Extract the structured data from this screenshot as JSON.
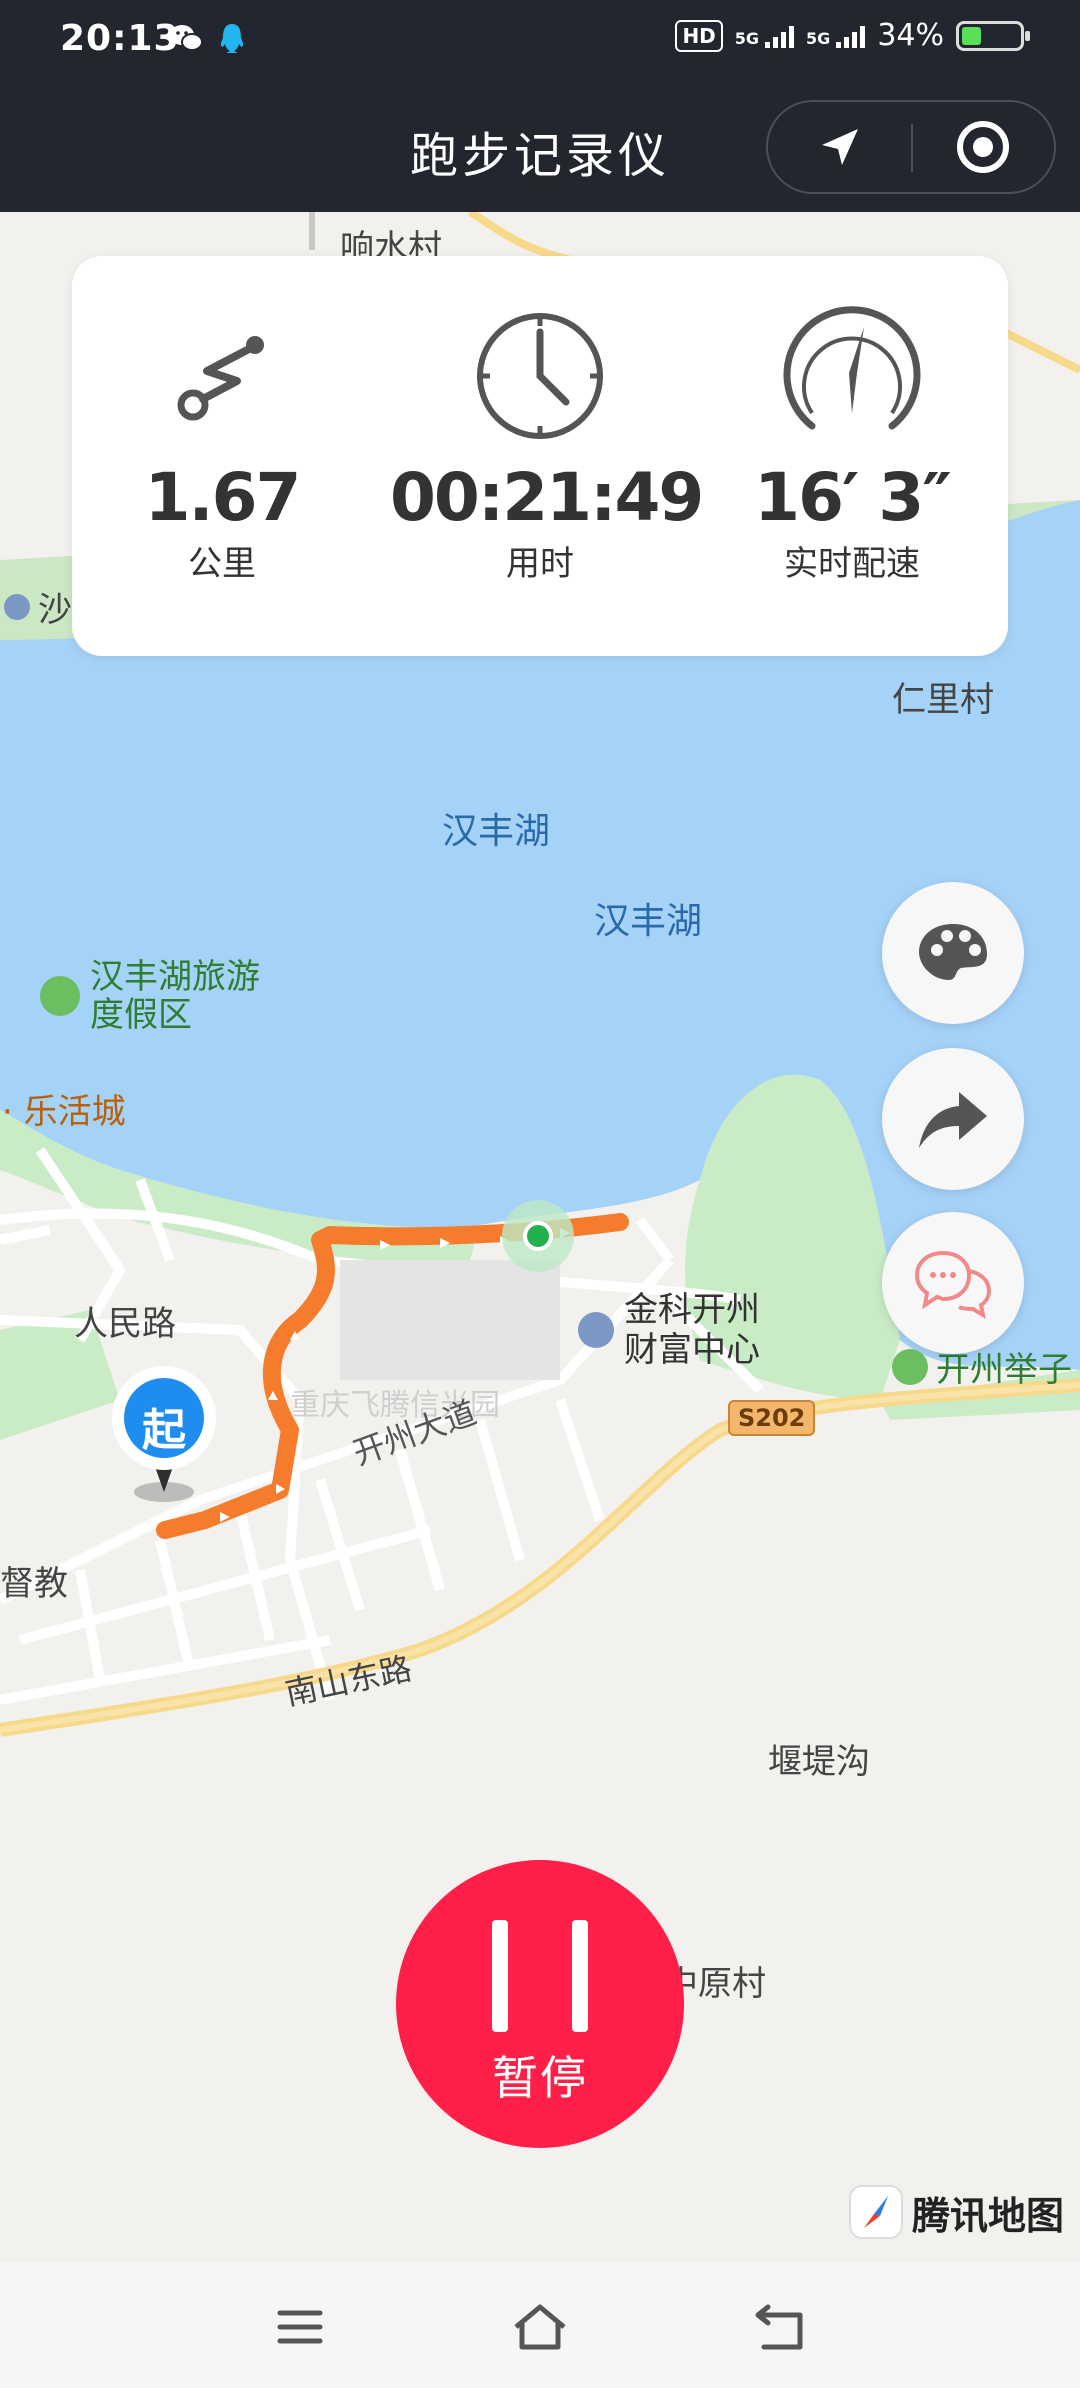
{
  "status_bar": {
    "time": "20:13",
    "hd_label": "HD",
    "network_1": "5G",
    "network_2": "5G",
    "battery_text": "34%",
    "battery_level": 0.34,
    "battery_color": "#59e05a"
  },
  "header": {
    "title": "跑步记录仪",
    "location_icon": "navigation-arrow-icon",
    "record_icon": "target-circle-icon"
  },
  "stats": {
    "distance": {
      "value": "1.67",
      "label": "公里",
      "icon": "route-icon"
    },
    "duration": {
      "value": "00:21:49",
      "label": "用时",
      "icon": "clock-icon"
    },
    "pace": {
      "value": "16′ 3″",
      "label": "实时配速",
      "icon": "speedometer-icon"
    }
  },
  "map": {
    "labels": {
      "xiangshui": "响水村",
      "sha": "沙",
      "renli": "仁里村",
      "lake1": "汉丰湖",
      "lake2": "汉丰湖",
      "resort_line1": "汉丰湖旅游",
      "resort_line2": "度假区",
      "lehuo": "乐活城",
      "renmin": "人民路",
      "jinke_line1": "金科开州",
      "jinke_line2": "财富中心",
      "kaizhou_juzi": "开州举子",
      "s202": "S202",
      "feiteng": "重庆飞腾信光园",
      "kaizhou_avenue": "开州大道",
      "dujiao": "督教",
      "nanshan": "南山东路",
      "yandigou": "堰堤沟",
      "zhongyuan": "中原村"
    },
    "start_marker": "起",
    "route_color": "#f47c2c",
    "water_color": "#a5d2f7"
  },
  "fabs": {
    "theme": "palette-icon",
    "share": "share-arrow-icon",
    "chat": "chat-bubbles-icon"
  },
  "pause_button": {
    "label": "暂停",
    "color": "#ff1f48"
  },
  "map_logo": {
    "text": "腾讯地图"
  },
  "nav_bar": {
    "menu": "menu-icon",
    "home": "home-icon",
    "back": "back-icon"
  }
}
